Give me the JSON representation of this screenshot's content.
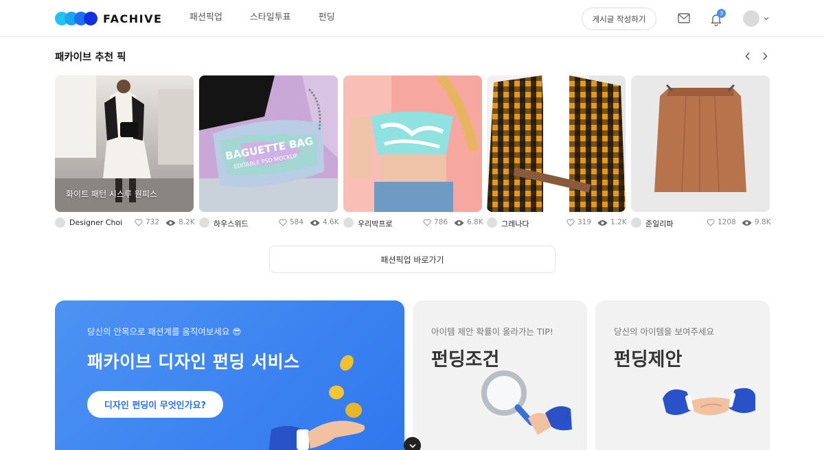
{
  "header": {
    "logo_text": "FACHIVE",
    "nav": [
      "패션픽업",
      "스타일투표",
      "펀딩"
    ],
    "write_label": "게시글 작성하기",
    "notification_count": "3",
    "icons": {
      "mail": "mail-icon",
      "bell": "bell-icon",
      "avatar": "avatar",
      "caret": "chevron-down-icon"
    }
  },
  "picks": {
    "title": "패카이브 추천 픽",
    "cards": [
      {
        "caption": "화이트 패턴 시스루 원피스",
        "author": "Designer Choi",
        "likes": "732",
        "views": "8.2K"
      },
      {
        "caption": "",
        "author": "하우스위드",
        "likes": "584",
        "views": "4.6K"
      },
      {
        "caption": "",
        "author": "우리박프로",
        "likes": "786",
        "views": "6.8K"
      },
      {
        "caption": "",
        "author": "그레나다",
        "likes": "319",
        "views": "1.2K"
      },
      {
        "caption": "",
        "author": "준일리파",
        "likes": "1208",
        "views": "9.8K"
      }
    ],
    "goto_label": "패션픽업 바로가기"
  },
  "banners": {
    "main": {
      "subtitle": "당신의 안목으로 패션계를 움직여보세요 😎",
      "title": "패카이브 디자인 펀딩 서비스",
      "button": "디자인 펀딩이 무엇인가요?"
    },
    "cards": [
      {
        "subtitle": "아이템 제안 확률이 올라가는 TIP!",
        "title": "펀딩조건"
      },
      {
        "subtitle": "당신의 아이템을 보여주세요",
        "title": "펀딩제안"
      }
    ]
  },
  "colors": {
    "accent": "#2f76ee",
    "badge": "#4a8cf6"
  }
}
